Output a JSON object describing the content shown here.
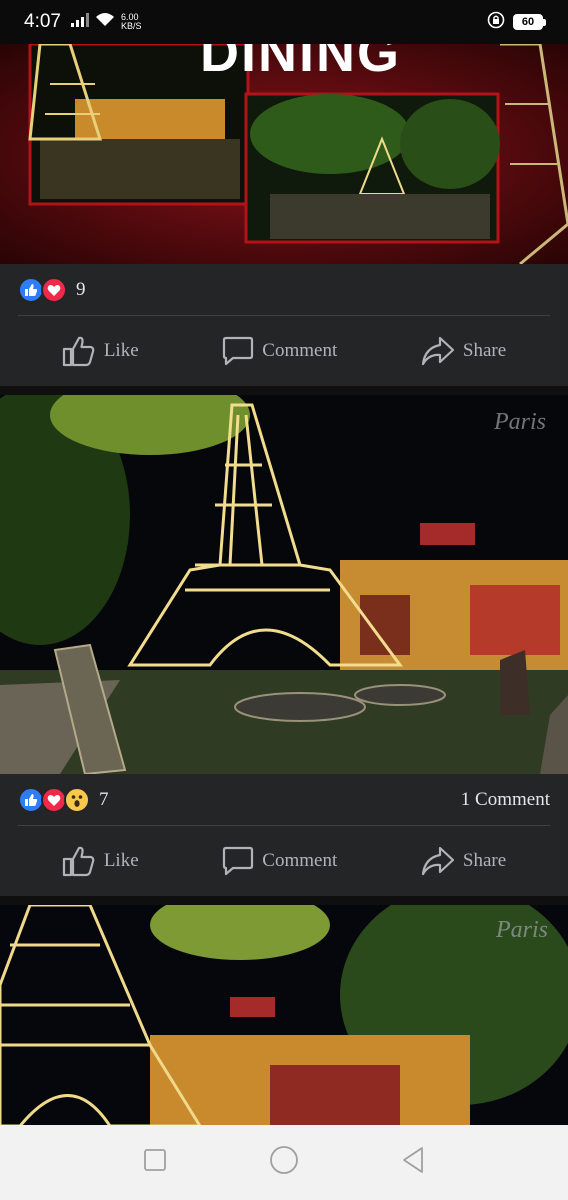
{
  "status_bar": {
    "time": "4:07",
    "net_speed_value": "6.00",
    "net_speed_unit": "KB/S",
    "battery": "60",
    "icons": [
      "signal-icon",
      "wifi-icon",
      "rotation-lock-icon",
      "battery-icon"
    ]
  },
  "post1": {
    "banner_text": "DINING",
    "reaction_count": "9",
    "reactions": [
      "like",
      "love"
    ]
  },
  "post2": {
    "watermark": "Paris",
    "reaction_count": "7",
    "reactions": [
      "like",
      "love",
      "wow"
    ],
    "comment_count": "1 Comment"
  },
  "post3": {
    "watermark": "Paris"
  },
  "actions": {
    "like": "Like",
    "comment": "Comment",
    "share": "Share"
  },
  "nav": {
    "icons": [
      "recent-apps-icon",
      "home-icon",
      "back-icon"
    ]
  },
  "colors": {
    "background": "#18191a",
    "card": "#242526",
    "like_blue": "#2e7cf6",
    "love_red": "#f0284a",
    "wow_yellow": "#f7c84a",
    "text_secondary": "#b0b3b8"
  }
}
